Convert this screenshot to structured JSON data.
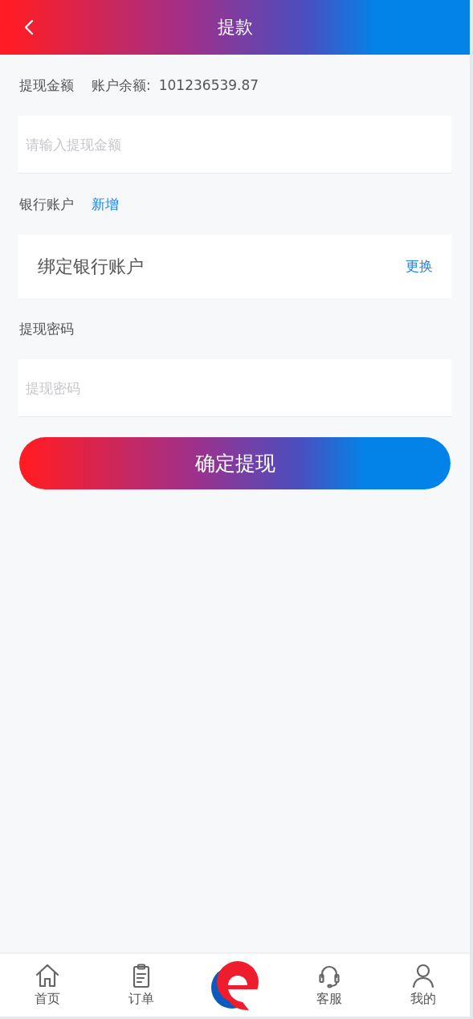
{
  "header": {
    "title": "提款"
  },
  "amount": {
    "label": "提现金额",
    "balance_label": "账户余额:",
    "balance": "101236539.87",
    "placeholder": "请输入提现金额"
  },
  "bank": {
    "label": "银行账户",
    "add_link": "新增",
    "account": "绑定银行账户",
    "change_link": "更换"
  },
  "password": {
    "label": "提现密码",
    "placeholder": "提现密码"
  },
  "submit_button": "确定提现",
  "tab_bar": [
    {
      "kind": "tab",
      "label": "首页"
    },
    {
      "kind": "tab",
      "label": "订单"
    },
    {
      "kind": "logo"
    },
    {
      "kind": "tab",
      "label": "客服"
    },
    {
      "kind": "tab",
      "label": "我的"
    }
  ]
}
